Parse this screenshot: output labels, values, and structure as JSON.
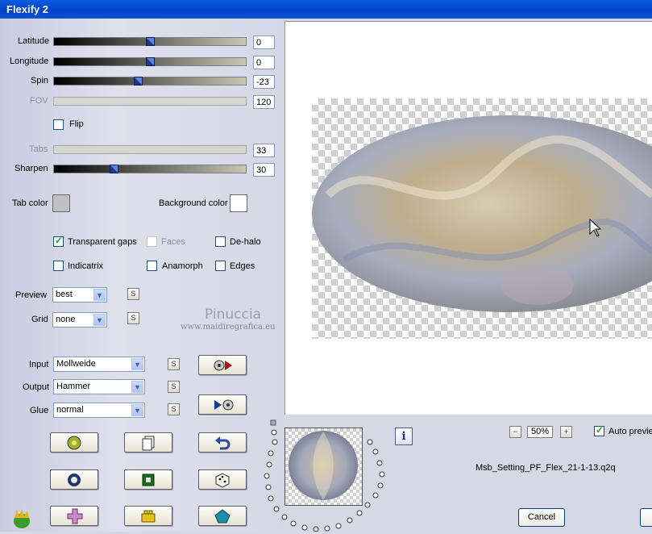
{
  "window": {
    "title": "Flexify 2"
  },
  "sliders": [
    {
      "label": "Latitude",
      "value": "0",
      "position": 0.5,
      "enabled": true
    },
    {
      "label": "Longitude",
      "value": "0",
      "position": 0.5,
      "enabled": true
    },
    {
      "label": "Spin",
      "value": "-23",
      "position": 0.43,
      "enabled": true
    },
    {
      "label": "FOV",
      "value": "120",
      "enabled": false
    },
    {
      "label": "Tabs",
      "value": "33",
      "enabled": false
    },
    {
      "label": "Sharpen",
      "value": "30",
      "position": 0.3,
      "enabled": true
    }
  ],
  "flip": {
    "label": "Flip",
    "checked": false
  },
  "colors": {
    "tab_color_label": "Tab color",
    "tab_color": "#c0c0c0",
    "background_color_label": "Background color",
    "background_color": "#ffffff"
  },
  "options": {
    "transparent_gaps": {
      "label": "Transparent gaps",
      "checked": true
    },
    "faces": {
      "label": "Faces",
      "checked": false,
      "enabled": false
    },
    "de_halo": {
      "label": "De-halo",
      "checked": false
    },
    "indicatrix": {
      "label": "Indicatrix",
      "checked": false
    },
    "anamorph": {
      "label": "Anamorph",
      "checked": false
    },
    "edges": {
      "label": "Edges",
      "checked": false
    }
  },
  "preview_mode": {
    "label": "Preview",
    "value": "best",
    "s_button": "S"
  },
  "grid": {
    "label": "Grid",
    "value": "none",
    "s_button": "S"
  },
  "watermark": {
    "line1": "Pinuccia",
    "line2": "www.maidiregrafica.eu"
  },
  "projection": {
    "input_label": "Input",
    "input_value": "Mollweide",
    "output_label": "Output",
    "output_value": "Hammer",
    "glue_label": "Glue",
    "glue_value": "normal",
    "s_button": "S"
  },
  "zoom": {
    "minus": "−",
    "value": "50%",
    "plus": "+"
  },
  "auto_preview": {
    "label": "Auto previe",
    "checked": true
  },
  "preset_file": "Msb_Setting_PF_Flex_21-1-13.q2q",
  "info_button": "i",
  "cancel_button": "Cancel",
  "icons": {
    "swap_forward": "disc-arrow-icon",
    "swap_back": "arrow-disc-icon",
    "tool1": "snail-icon",
    "tool2": "copy-icon",
    "tool3": "undo-icon",
    "tool4": "ring-icon",
    "tool5": "square-icon",
    "tool6": "dice-icon",
    "tool7": "cross-icon",
    "tool8": "lego-icon",
    "tool9": "pentagon-icon",
    "logo": "flaming-pear-icon"
  }
}
